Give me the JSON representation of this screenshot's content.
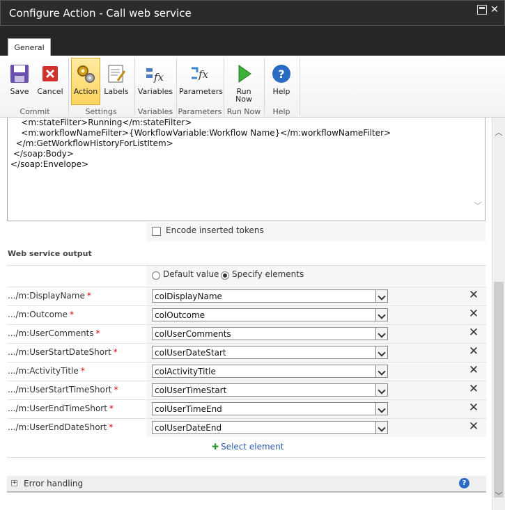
{
  "window": {
    "title": "Configure Action - Call web service",
    "max_icon": "maximize-icon",
    "close_label": "✕"
  },
  "ribbon": {
    "tab": "General",
    "buttons": {
      "save": "Save",
      "cancel": "Cancel",
      "action": "Action",
      "labels": "Labels",
      "variables": "Variables",
      "parameters": "Parameters",
      "run_now_1": "Run",
      "run_now_2": "Now",
      "help": "Help"
    },
    "groups": {
      "commit": "Commit",
      "settings": "Settings",
      "variables": "Variables",
      "parameters": "Parameters",
      "run_now": "Run Now",
      "help": "Help"
    }
  },
  "code": {
    "lines": [
      "    <m:stateFilter>Running</m:stateFilter>",
      "    <m:workflowNameFilter>{WorkflowVariable:Workflow Name}</m:workflowNameFilter>",
      "  </m:GetWorkflowHistoryForListItem>",
      " </soap:Body>",
      "</soap:Envelope>"
    ]
  },
  "encode": {
    "label": "Encode inserted tokens",
    "checked": false
  },
  "output": {
    "heading": "Web service output",
    "radio_default": "Default value",
    "radio_specify": "Specify elements",
    "selected_mode": "specify",
    "rows": [
      {
        "param": ".../m:DisplayName",
        "value": "colDisplayName"
      },
      {
        "param": ".../m:Outcome",
        "value": "colOutcome"
      },
      {
        "param": ".../m:UserComments",
        "value": "colUserComments"
      },
      {
        "param": ".../m:UserStartDateShort",
        "value": "colUserDateStart"
      },
      {
        "param": ".../m:ActivityTitle",
        "value": "colActivityTitle"
      },
      {
        "param": ".../m:UserStartTimeShort",
        "value": "colUserTimeStart"
      },
      {
        "param": ".../m:UserEndTimeShort",
        "value": "colUserTimeEnd"
      },
      {
        "param": ".../m:UserEndDateShort",
        "value": "colUserDateEnd"
      }
    ],
    "required_mark": "*",
    "delete_glyph": "✕",
    "select_element": "Select element"
  },
  "error_handling": {
    "label": "Error handling",
    "help_glyph": "?"
  },
  "colors": {
    "title_bg": "#2b2b2b",
    "link": "#2a5aa8",
    "active_button": "#fbd560"
  }
}
